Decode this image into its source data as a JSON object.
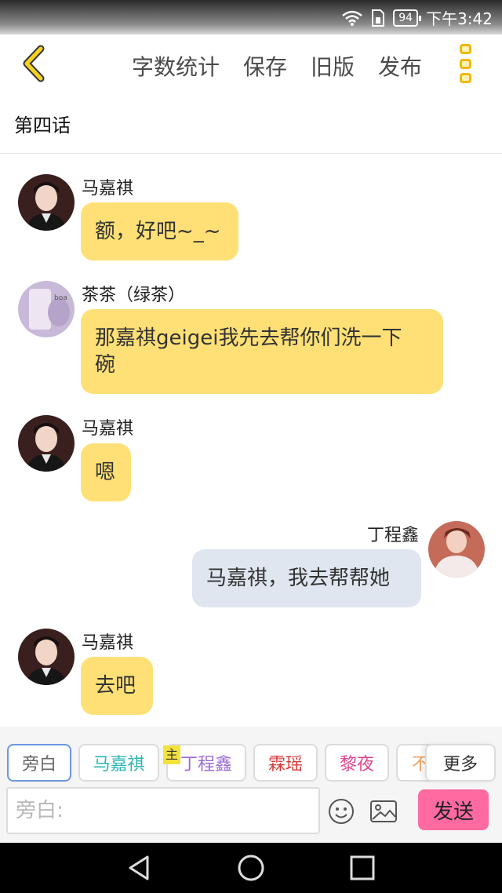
{
  "status": {
    "battery": "94",
    "time": "下午3:42"
  },
  "toolbar": {
    "actions": [
      "字数统计",
      "保存",
      "旧版",
      "发布"
    ]
  },
  "chapter": {
    "title": "第四话"
  },
  "messages": [
    {
      "speaker": "马嘉祺",
      "text": "额，好吧~_~",
      "side": "left"
    },
    {
      "speaker": "茶茶（绿茶）",
      "text_line1": "那嘉祺geigei我先去帮你们洗一下",
      "text_line2": "碗",
      "side": "left"
    },
    {
      "speaker": "马嘉祺",
      "text": "嗯",
      "side": "left"
    },
    {
      "speaker": "丁程鑫",
      "text": "马嘉祺，我去帮帮她",
      "side": "right"
    },
    {
      "speaker": "马嘉祺",
      "text": "去吧",
      "side": "left"
    }
  ],
  "roles": [
    {
      "label": "旁白",
      "color": "#666666"
    },
    {
      "label": "马嘉祺",
      "color": "#2bb5b5"
    },
    {
      "label": "丁程鑫",
      "color": "#9b6bd6"
    },
    {
      "label": "霖瑶",
      "color": "#d93a3a"
    },
    {
      "label": "黎夜",
      "color": "#e0458f"
    },
    {
      "label": "不",
      "color": "#f0a060"
    }
  ],
  "owner_tag": "主",
  "more_label": "更多",
  "input": {
    "placeholder": "旁白:"
  },
  "send_label": "发送",
  "colors": {
    "accent_yellow": "#fee076",
    "send_pink": "#ff6aa1",
    "bubble_blue": "#dfe6ef"
  }
}
